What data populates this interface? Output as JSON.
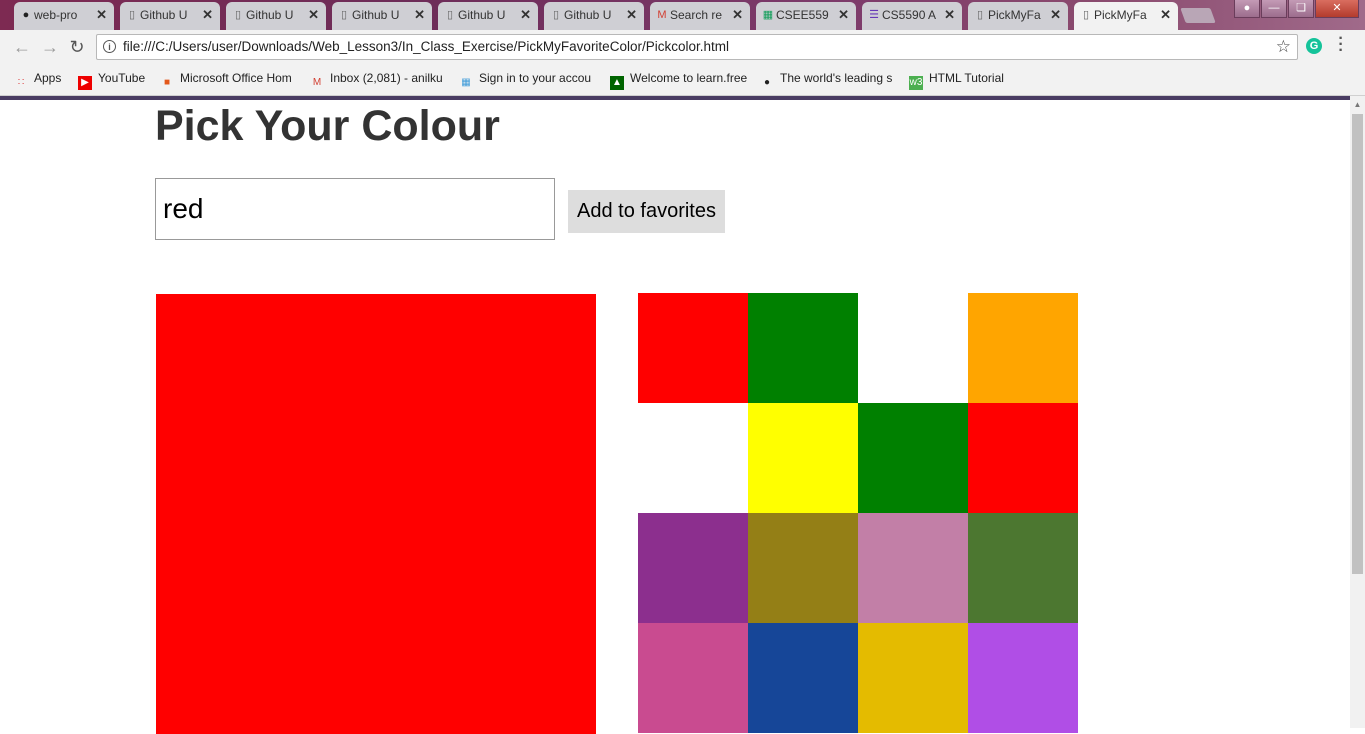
{
  "browser": {
    "tabs": [
      {
        "label": "web-pro",
        "icon": "github-icon",
        "active": false
      },
      {
        "label": "Github U",
        "icon": "page-icon",
        "active": false
      },
      {
        "label": "Github U",
        "icon": "page-icon",
        "active": false
      },
      {
        "label": "Github U",
        "icon": "page-icon",
        "active": false
      },
      {
        "label": "Github U",
        "icon": "page-icon",
        "active": false
      },
      {
        "label": "Github U",
        "icon": "page-icon",
        "active": false
      },
      {
        "label": "Search re",
        "icon": "gmail-icon",
        "active": false
      },
      {
        "label": "CSEE559",
        "icon": "sheets-icon",
        "active": false
      },
      {
        "label": "CS5590 A",
        "icon": "forms-icon",
        "active": false
      },
      {
        "label": "PickMyFa",
        "icon": "page-icon",
        "active": false
      },
      {
        "label": "PickMyFa",
        "icon": "page-icon",
        "active": true
      }
    ],
    "url": "file:///C:/Users/user/Downloads/Web_Lesson3/In_Class_Exercise/PickMyFavoriteColor/Pickcolor.html",
    "bookmarks": [
      {
        "label": "Apps",
        "icon": "apps-grid-icon"
      },
      {
        "label": "YouTube",
        "icon": "youtube-icon"
      },
      {
        "label": "Microsoft Office Hom",
        "icon": "office-icon"
      },
      {
        "label": "Inbox (2,081) - anilku",
        "icon": "gmail-icon"
      },
      {
        "label": "Sign in to your accou",
        "icon": "microsoft-icon"
      },
      {
        "label": "Welcome to learn.free",
        "icon": "freecodecamp-icon"
      },
      {
        "label": "The world's leading s",
        "icon": "github-icon"
      },
      {
        "label": "HTML Tutorial",
        "icon": "w3schools-icon"
      }
    ]
  },
  "page": {
    "title": "Pick Your Colour",
    "input_value": "red",
    "add_button": "Add to favorites",
    "preview_color": "#ff0000",
    "swatches": [
      "#ff0000",
      "#008000",
      "#ffffff",
      "#ffa500",
      "#ffffff",
      "#ffff00",
      "#008000",
      "#ff0000",
      "#8c2f8e",
      "#947f16",
      "#c27fa7",
      "#4c7730",
      "#c94b90",
      "#164698",
      "#e4bb00",
      "#b04ee6"
    ]
  }
}
